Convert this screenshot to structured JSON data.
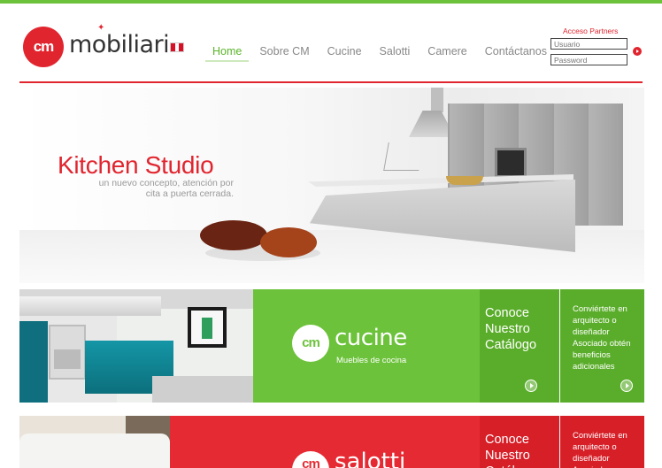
{
  "brand": {
    "logo_mark": "cm",
    "logo_word": "mobiliari",
    "flag": "peru-flag-icon"
  },
  "nav": {
    "items": [
      {
        "label": "Home",
        "active": true
      },
      {
        "label": "Sobre CM",
        "active": false
      },
      {
        "label": "Cucine",
        "active": false
      },
      {
        "label": "Salotti",
        "active": false
      },
      {
        "label": "Camere",
        "active": false
      },
      {
        "label": "Contáctanos",
        "active": false
      }
    ]
  },
  "login": {
    "title": "Acceso Partners",
    "user_placeholder": "Usuario",
    "password_placeholder": "Password",
    "submit_icon": "arrow-right-circle-icon"
  },
  "hero": {
    "title": "Kitchen Studio",
    "subtitle": "un nuevo concepto, atención por cita a puerta cerrada."
  },
  "cucine": {
    "logo_mark": "cm",
    "brand_word": "cucine",
    "tagline": "Muebles de cocina",
    "catalog_text": "Conoce Nuestro Catálogo",
    "promo_text": "Conviértete en arquitecto o diseñador Asociado obtén beneficios adicionales"
  },
  "salotti": {
    "logo_mark": "cm",
    "brand_word": "salotti",
    "catalog_text": "Conoce Nuestro Catálogo",
    "promo_text": "Conviértete en arquitecto o diseñador Asociado"
  },
  "colors": {
    "accent_green": "#6cc23a",
    "accent_red": "#e1252f"
  }
}
